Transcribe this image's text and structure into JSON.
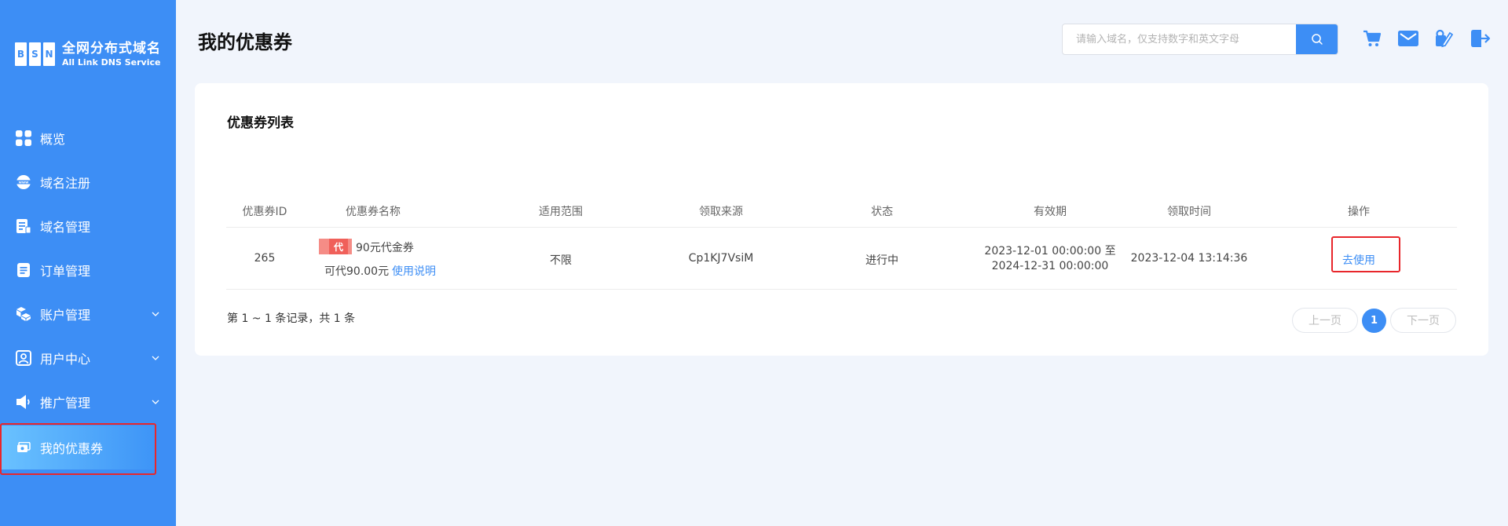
{
  "sidebar": {
    "logo_letters": [
      "B",
      "S",
      "N"
    ],
    "logo_cn": "全网分布式域名",
    "logo_en": "All Link DNS Service",
    "items": [
      {
        "label": "概览",
        "icon": "grid-icon"
      },
      {
        "label": "域名注册",
        "icon": "www-icon"
      },
      {
        "label": "域名管理",
        "icon": "document-icon"
      },
      {
        "label": "订单管理",
        "icon": "list-icon"
      },
      {
        "label": "账户管理",
        "icon": "cubes-icon",
        "expandable": true
      },
      {
        "label": "用户中心",
        "icon": "user-icon",
        "expandable": true
      },
      {
        "label": "推广管理",
        "icon": "speaker-icon",
        "expandable": true
      },
      {
        "label": "我的优惠券",
        "icon": "coupon-icon",
        "active": true
      }
    ]
  },
  "header": {
    "title": "我的优惠券",
    "search_placeholder": "请输入域名，仅支持数字和英文字母",
    "icons": [
      "cart-icon",
      "mail-icon",
      "edit-user-icon",
      "logout-icon"
    ]
  },
  "card": {
    "title": "优惠券列表",
    "columns": [
      "优惠券ID",
      "优惠券名称",
      "适用范围",
      "领取来源",
      "状态",
      "有效期",
      "领取时间",
      "操作"
    ],
    "rows": [
      {
        "id": "265",
        "tag": "代",
        "name": "90元代金券",
        "amount": "可代90.00元",
        "instructions": "使用说明",
        "scope": "不限",
        "source": "Cp1KJ7VsiM",
        "status": "进行中",
        "validity_line1": "2023-12-01 00:00:00 至",
        "validity_line2": "2024-12-31 00:00:00",
        "received": "2023-12-04 13:14:36",
        "action": "去使用"
      }
    ]
  },
  "pagination": {
    "summary": "第 1 ~ 1 条记录，共 1 条",
    "prev": "上一页",
    "current": "1",
    "next": "下一页"
  },
  "colors": {
    "primary": "#3d8ef5",
    "highlight": "#e8262b",
    "tag": "#f0605a"
  }
}
